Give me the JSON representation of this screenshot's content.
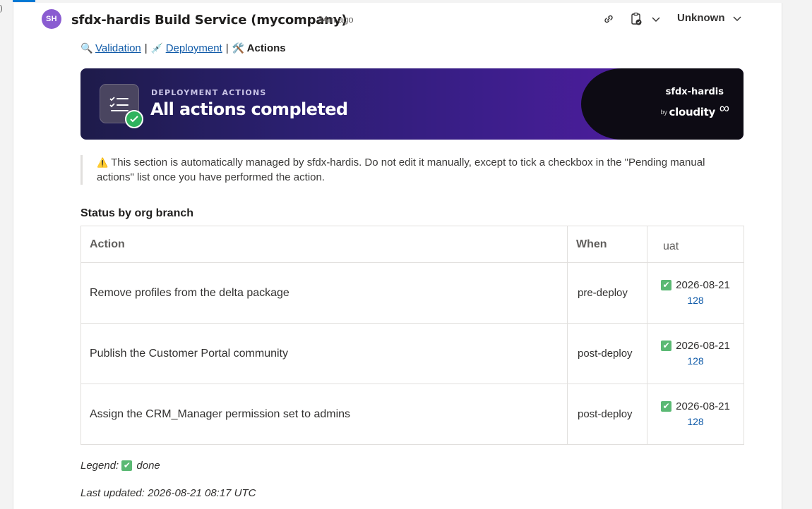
{
  "gutter_mark": ")",
  "header": {
    "avatar_initials": "SH",
    "author": "sfdx-hardis Build Service (mycompany)",
    "timestamp": "34m ago",
    "status_label": "Unknown",
    "icons": [
      "link-icon",
      "clipboard-check-icon",
      "chevron-down-icon"
    ]
  },
  "tabs": [
    {
      "icon": "🔍",
      "label": "Validation",
      "link": true
    },
    {
      "icon": "💉",
      "label": "Deployment",
      "link": true
    },
    {
      "icon": "🛠️",
      "label": "Actions",
      "link": false
    }
  ],
  "tab_separator": "|",
  "banner": {
    "kicker": "DEPLOYMENT ACTIONS",
    "title": "All actions completed",
    "brand_name": "sfdx-hardis",
    "brand_by": "by",
    "brand_company": "cloudity",
    "brand_symbol": "∞"
  },
  "notice": {
    "icon": "⚠️",
    "text": "This section is automatically managed by sfdx-hardis. Do not edit it manually, except to tick a checkbox in the \"Pending manual actions\" list once you have performed the action."
  },
  "status_title": "Status by org branch",
  "table": {
    "headers": [
      "Action",
      "When",
      "uat"
    ],
    "rows": [
      {
        "action": "Remove profiles from the delta package",
        "when": "pre-deploy",
        "status_icon": "✔",
        "date": "2026-08-21",
        "run": "128"
      },
      {
        "action": "Publish the Customer Portal community",
        "when": "post-deploy",
        "status_icon": "✔",
        "date": "2026-08-21",
        "run": "128"
      },
      {
        "action": "Assign the CRM_Manager permission set to admins",
        "when": "post-deploy",
        "status_icon": "✔",
        "date": "2026-08-21",
        "run": "128"
      }
    ]
  },
  "legend": {
    "label": "Legend:",
    "icon": "✔",
    "text": "done"
  },
  "last_updated": "Last updated: 2026-08-21 08:17 UTC",
  "colors": {
    "accent": "#0078d4",
    "avatar": "#8a5cd1",
    "done_green": "#5bb974",
    "link": "#0f5aa8"
  }
}
